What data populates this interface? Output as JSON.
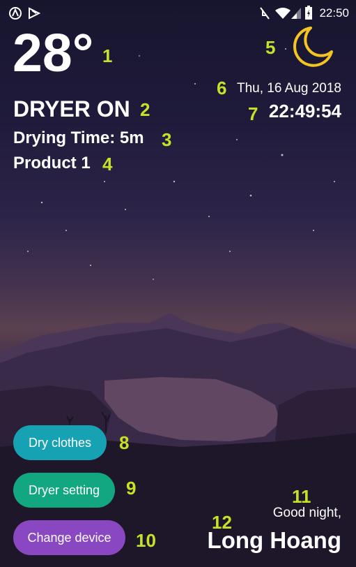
{
  "status_bar": {
    "time": "22:50"
  },
  "weather": {
    "temperature": "28°",
    "icon": "crescent-moon-icon"
  },
  "dryer": {
    "status": "DRYER ON",
    "drying_time": "Drying Time: 5m",
    "product": "Product 1"
  },
  "datetime": {
    "date": "Thu, 16 Aug 2018",
    "time": "22:49:54"
  },
  "buttons": {
    "dry_clothes": "Dry clothes",
    "dryer_setting": "Dryer setting",
    "change_device": "Change device"
  },
  "greeting": {
    "text": "Good night,",
    "user_name": "Long Hoang"
  },
  "annotations": [
    "1",
    "2",
    "3",
    "4",
    "5",
    "6",
    "7",
    "8",
    "9",
    "10",
    "11",
    "12"
  ],
  "colors": {
    "dry_clothes": "#17a2b3",
    "dryer_setting": "#12a681",
    "change_device": "#8a47c2",
    "marker": "#c6e227",
    "moon": "#f2c524"
  }
}
